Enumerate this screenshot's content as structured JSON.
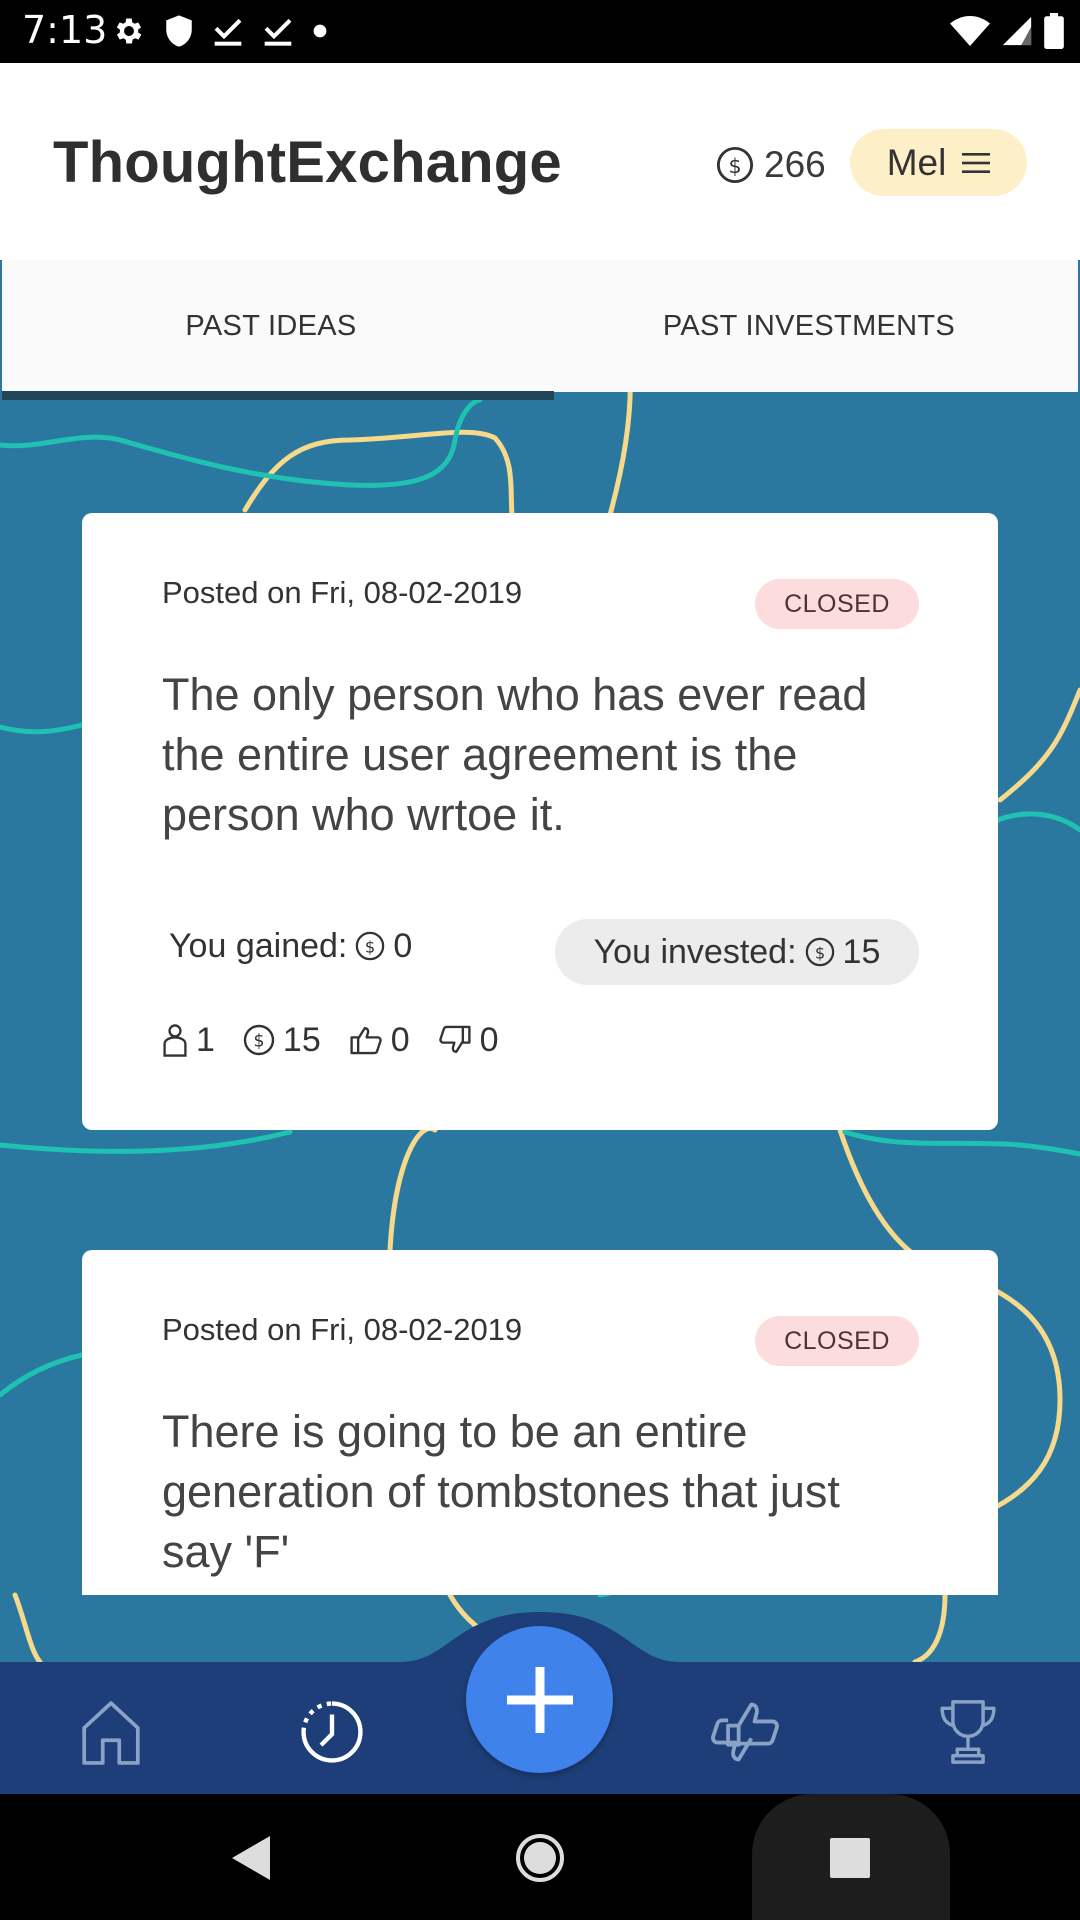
{
  "status_bar": {
    "time": "7:13",
    "left_icons": [
      "gear-icon",
      "shield-icon",
      "checkmark-download-icon",
      "checkmark-download-icon",
      "dot-icon"
    ],
    "right_icons": [
      "wifi-icon",
      "signal-icon",
      "battery-icon"
    ]
  },
  "header": {
    "title": "ThoughtExchange",
    "coin_balance": "266",
    "user_name": "Mel",
    "colors": {
      "user_pill": "#fdefc7"
    }
  },
  "tabs": [
    {
      "label": "PAST IDEAS",
      "selected": true
    },
    {
      "label": "PAST INVESTMENTS",
      "selected": false
    }
  ],
  "cards": [
    {
      "date": "Posted on Fri, 08-02-2019",
      "status": "CLOSED",
      "text": "The only person who has ever read the entire user agreement is the person who wrtoe it.",
      "gained_label": "You gained:",
      "gained_value": "0",
      "invested_label": "You invested:",
      "invested_value": "15",
      "stats": {
        "investors": "1",
        "coins": "15",
        "likes": "0",
        "dislikes": "0"
      }
    },
    {
      "date": "Posted on Fri, 08-02-2019",
      "status": "CLOSED",
      "text": "There is going to be an entire generation of tombstones that just say 'F'"
    }
  ],
  "bottom_nav": {
    "items": [
      "home-icon",
      "history-icon",
      "add-icon",
      "investments-icon",
      "trophy-icon"
    ],
    "active": "history-icon",
    "colors": {
      "bar": "#1d3e78",
      "fab": "#3f82ec"
    }
  },
  "colors": {
    "background": "#2a78a0",
    "badge_closed": "#fddcdd",
    "curve_yellow": "#f6d98a",
    "curve_teal": "#1fc2b0"
  }
}
